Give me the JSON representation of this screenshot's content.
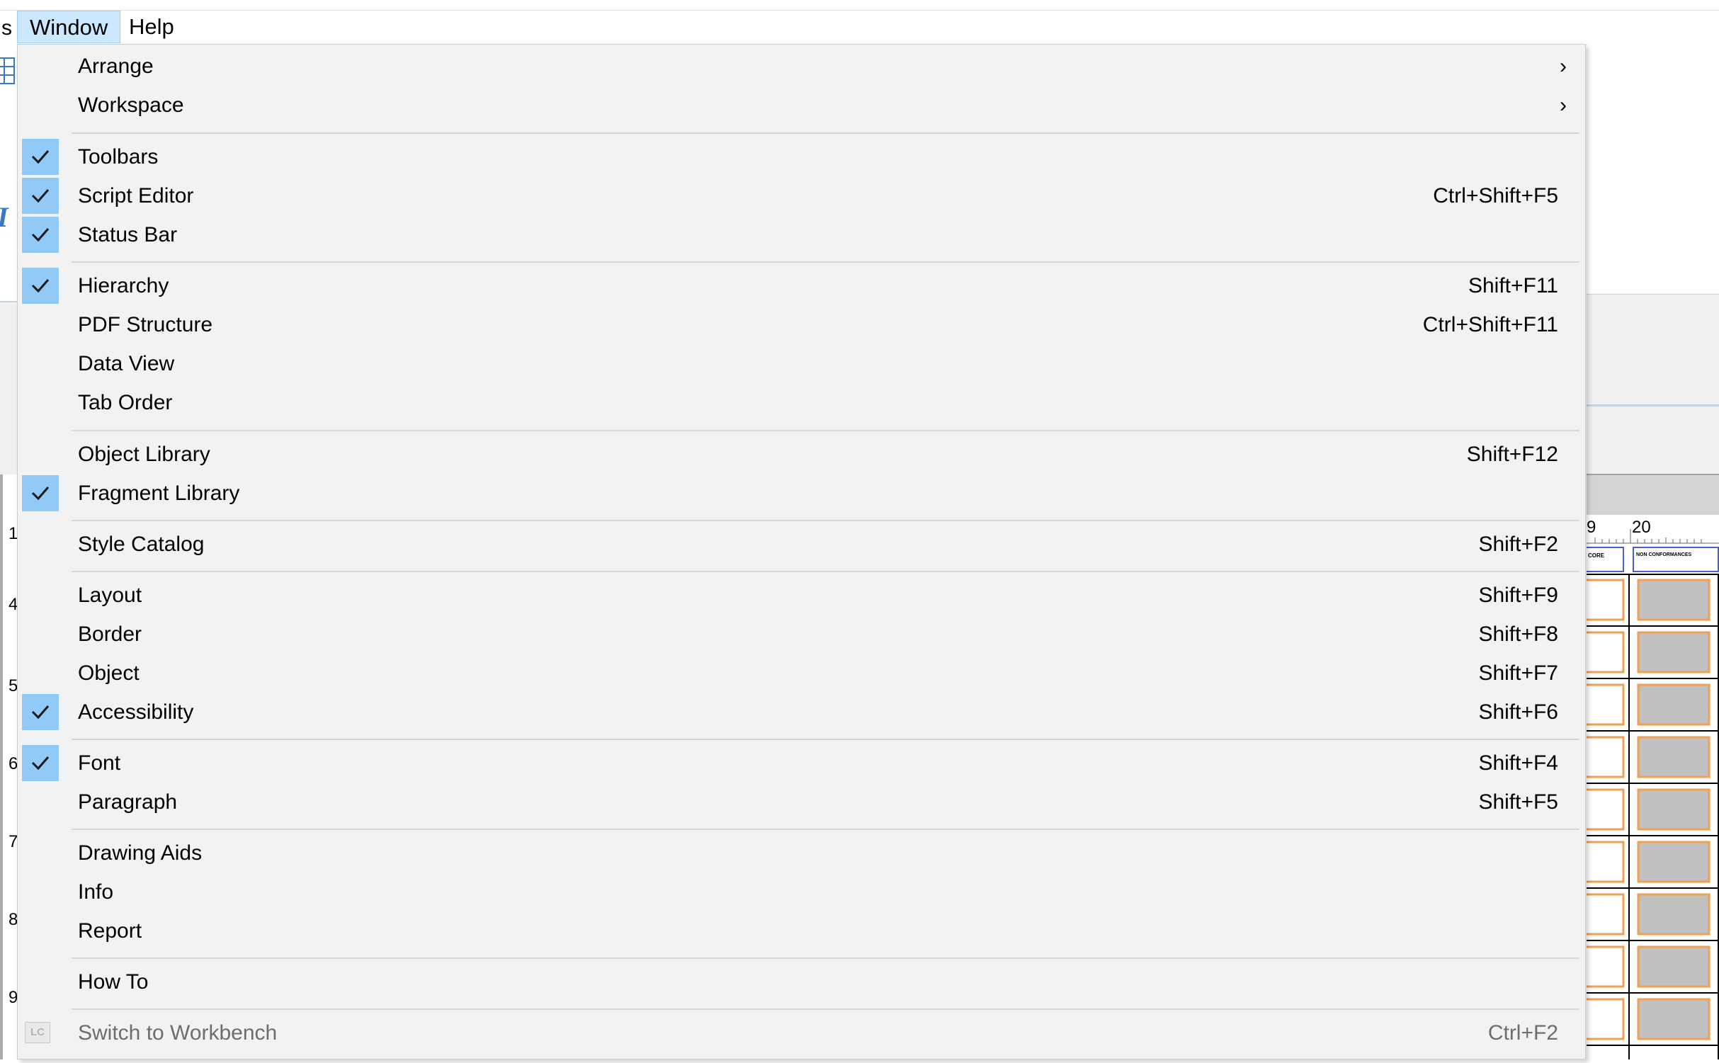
{
  "menubar": {
    "prev_fragment": "s",
    "window_label": "Window",
    "help_label": "Help"
  },
  "background": {
    "left_ruler_numbers": [
      "1",
      "4",
      "5",
      "6",
      "7",
      "8",
      "9"
    ],
    "right_ruler_numbers": [
      "9",
      "20"
    ],
    "right_column_header": "NON CONFORMANCES",
    "right_column_header_partial": "CORE"
  },
  "window_menu": {
    "items": [
      {
        "label": "Arrange",
        "shortcut": "",
        "checked": false,
        "submenu": true
      },
      {
        "label": "Workspace",
        "shortcut": "",
        "checked": false,
        "submenu": true
      },
      {
        "label": "Toolbars",
        "shortcut": "",
        "checked": true
      },
      {
        "label": "Script Editor",
        "shortcut": "Ctrl+Shift+F5",
        "checked": true
      },
      {
        "label": "Status Bar",
        "shortcut": "",
        "checked": true
      },
      {
        "label": "Hierarchy",
        "shortcut": "Shift+F11",
        "checked": true
      },
      {
        "label": "PDF Structure",
        "shortcut": "Ctrl+Shift+F11",
        "checked": false
      },
      {
        "label": "Data View",
        "shortcut": "",
        "checked": false
      },
      {
        "label": "Tab Order",
        "shortcut": "",
        "checked": false
      },
      {
        "label": "Object Library",
        "shortcut": "Shift+F12",
        "checked": false
      },
      {
        "label": "Fragment Library",
        "shortcut": "",
        "checked": true
      },
      {
        "label": "Style Catalog",
        "shortcut": "Shift+F2",
        "checked": false
      },
      {
        "label": "Layout",
        "shortcut": "Shift+F9",
        "checked": false
      },
      {
        "label": "Border",
        "shortcut": "Shift+F8",
        "checked": false
      },
      {
        "label": "Object",
        "shortcut": "Shift+F7",
        "checked": false
      },
      {
        "label": "Accessibility",
        "shortcut": "Shift+F6",
        "checked": true
      },
      {
        "label": "Font",
        "shortcut": "Shift+F4",
        "checked": true
      },
      {
        "label": "Paragraph",
        "shortcut": "Shift+F5",
        "checked": false
      },
      {
        "label": "Drawing Aids",
        "shortcut": "",
        "checked": false
      },
      {
        "label": "Info",
        "shortcut": "",
        "checked": false
      },
      {
        "label": "Report",
        "shortcut": "",
        "checked": false
      },
      {
        "label": "How To",
        "shortcut": "",
        "checked": false
      },
      {
        "label": "Switch to Workbench",
        "shortcut": "Ctrl+F2",
        "checked": false,
        "disabled": true,
        "icon": "lc-icon",
        "icon_text": "LC"
      }
    ]
  },
  "colors": {
    "menu_bg": "#f2f2f2",
    "check_bg": "#91c9f7",
    "active_menu_bg": "#cce8ff",
    "disabled_text": "#6d6d6d",
    "form_field_orange": "#f0a050",
    "form_field_gray": "#c0c0c0"
  }
}
